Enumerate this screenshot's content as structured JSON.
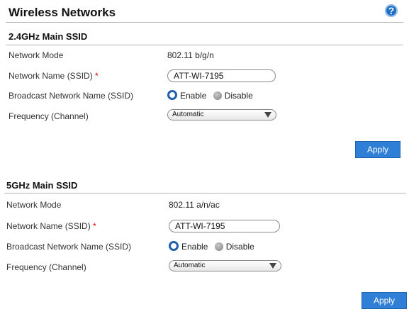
{
  "page": {
    "title": "Wireless Networks",
    "help_glyph": "?"
  },
  "band24": {
    "section_title": "2.4GHz Main SSID",
    "network_mode_label": "Network Mode",
    "network_mode_value": "802.11 b/g/n",
    "ssid_label": "Network Name (SSID)",
    "required_mark": "*",
    "ssid_value": "ATT-WI-7195",
    "broadcast_label": "Broadcast Network Name (SSID)",
    "broadcast_enable": "Enable",
    "broadcast_disable": "Disable",
    "broadcast_selected": "Enable",
    "frequency_label": "Frequency (Channel)",
    "frequency_value": "Automatic",
    "apply_label": "Apply"
  },
  "band5": {
    "section_title": "5GHz Main SSID",
    "network_mode_label": "Network Mode",
    "network_mode_value": "802.11 a/n/ac",
    "ssid_label": "Network Name (SSID)",
    "required_mark": "*",
    "ssid_value": "ATT-WI-7195",
    "broadcast_label": "Broadcast Network Name (SSID)",
    "broadcast_enable": "Enable",
    "broadcast_disable": "Disable",
    "broadcast_selected": "Enable",
    "frequency_label": "Frequency (Channel)",
    "frequency_value": "Automatic",
    "apply_label": "Apply"
  },
  "colors": {
    "accent": "#2f7fd6",
    "required": "#dd0000"
  }
}
